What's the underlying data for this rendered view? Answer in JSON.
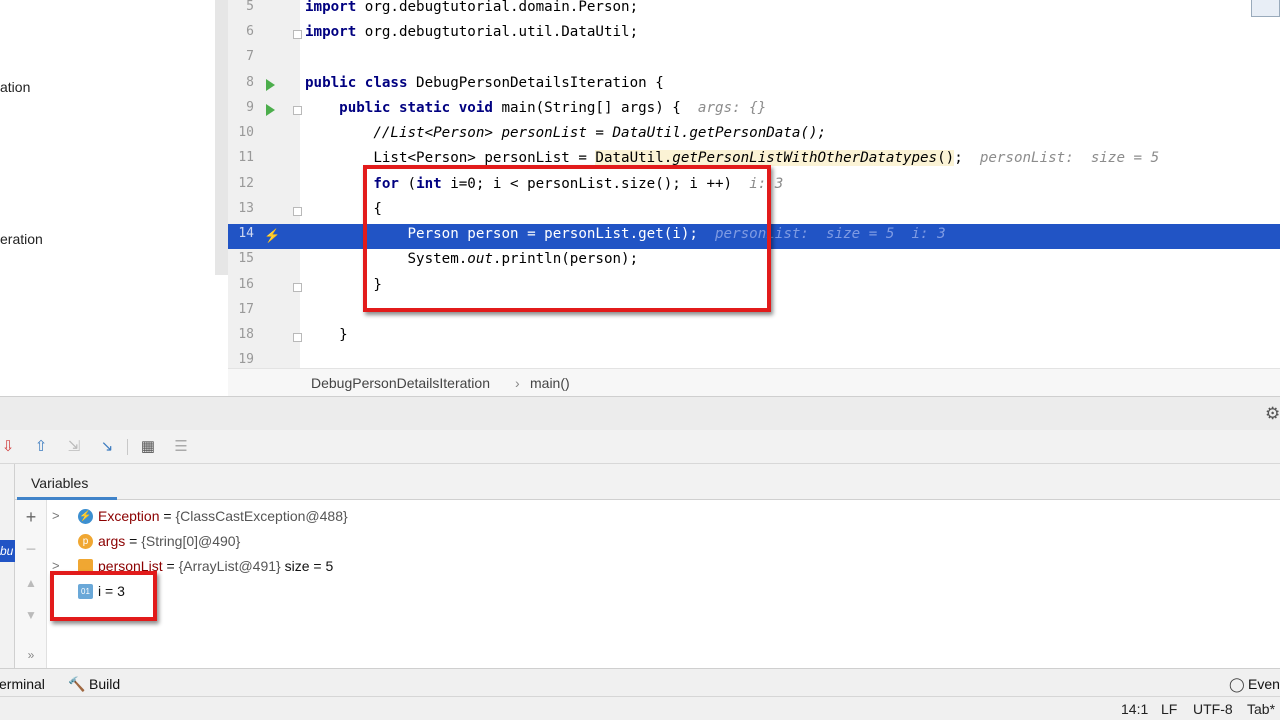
{
  "project_panel": {
    "stub_1": "ation",
    "stub_2": "eration"
  },
  "editor": {
    "lines": [
      {
        "num": "5",
        "code": "import org.debugtutorial.domain.Person;"
      },
      {
        "num": "6",
        "code": "import org.debugtutorial.util.DataUtil;"
      },
      {
        "num": "7",
        "code": ""
      },
      {
        "num": "8",
        "code": "public class DebugPersonDetailsIteration {"
      },
      {
        "num": "9",
        "code": "    public static void main(String[] args) {",
        "hint": "args: {}"
      },
      {
        "num": "10",
        "code": "        //List<Person> personList = DataUtil.getPersonData();"
      },
      {
        "num": "11",
        "code": "        List<Person> personList = DataUtil.getPersonListWithOtherDatatypes();",
        "hint": "personList:  size = 5"
      },
      {
        "num": "12",
        "code": "        for (int i=0; i < personList.size(); i ++)",
        "hint": "i: 3"
      },
      {
        "num": "13",
        "code": "        {"
      },
      {
        "num": "14",
        "code": "            Person person = personList.get(i);",
        "hint": "personList:  size = 5  i: 3"
      },
      {
        "num": "15",
        "code": "            System.out.println(person);"
      },
      {
        "num": "16",
        "code": "        }"
      },
      {
        "num": "17",
        "code": ""
      },
      {
        "num": "18",
        "code": "    }"
      },
      {
        "num": "19",
        "code": ""
      }
    ]
  },
  "breadcrumb": {
    "class_name": "DebugPersonDetailsIteration",
    "separator": "›",
    "method": "main()"
  },
  "debug": {
    "variables_tab": "Variables",
    "frames_stub": "bu",
    "variables": [
      {
        "name": "Exception",
        "value": "{ClassCastException@488}",
        "icon": "exception-icon",
        "expandable": true
      },
      {
        "name": "args",
        "value": "{String[0]@490}",
        "icon": "parameter-icon",
        "expandable": false,
        "icon_letter": "p"
      },
      {
        "name": "personList",
        "value": "{ArrayList@491}",
        "extra": "size = 5",
        "icon": "field-icon",
        "expandable": true
      },
      {
        "name": "i",
        "value": "3",
        "icon": "primitive-icon",
        "expandable": false,
        "icon_letter": "01"
      }
    ],
    "side_plus": "+",
    "side_minus": "−",
    "side_more": "»"
  },
  "tool_tabs": {
    "terminal": "erminal",
    "build": "Build",
    "event_log": "Event"
  },
  "status": {
    "position": "14:1",
    "line_sep": "LF",
    "encoding": "UTF-8",
    "indent": "Tab*"
  },
  "colors": {
    "exec_line": "#2154c5",
    "keyword": "#000080",
    "annotation_red": "#e21b1b",
    "run_green": "#4cae4c"
  }
}
